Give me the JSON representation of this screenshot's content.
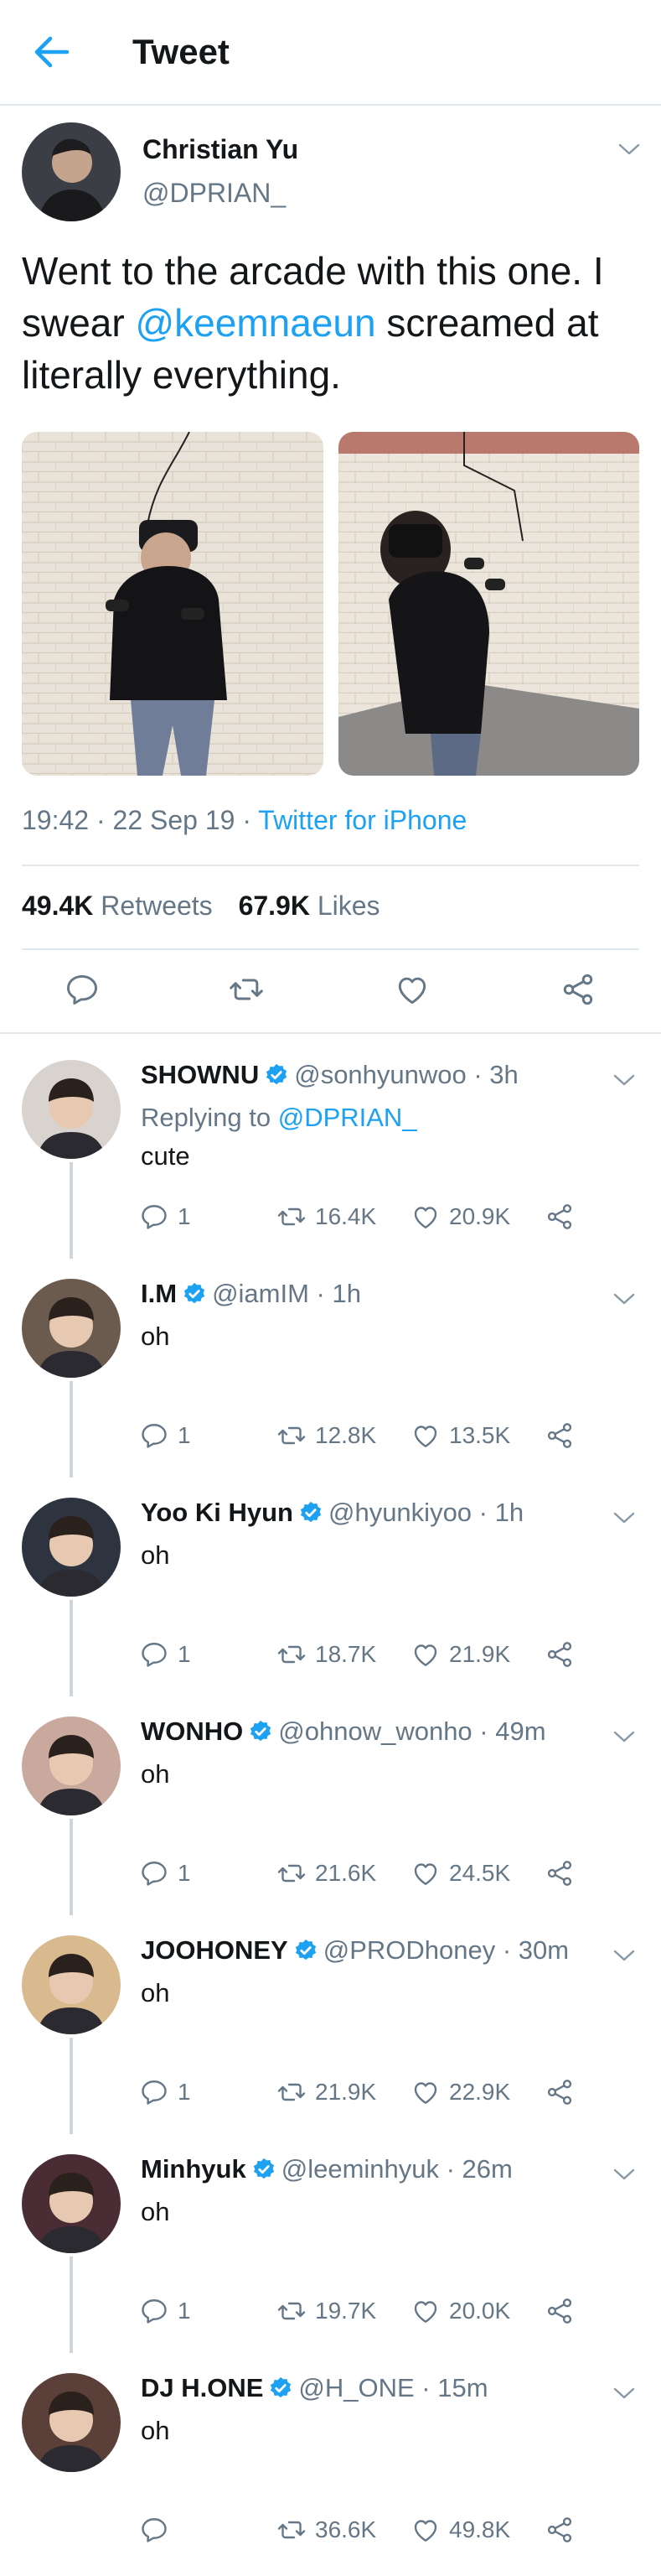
{
  "header": {
    "title": "Tweet"
  },
  "tweet": {
    "author_name": "Christian Yu",
    "author_handle": "@DPRIAN_",
    "text_before": "Went to the arcade with this one. I swear ",
    "mention": "@keemnaeun",
    "text_after": " screamed at literally everything.",
    "time_date": "19:42 · 22 Sep 19 · ",
    "source": "Twitter for iPhone",
    "retweets_count": "49.4K",
    "retweets_label": "Retweets",
    "likes_count": "67.9K",
    "likes_label": "Likes"
  },
  "replies": [
    {
      "name": "SHOWNU",
      "handle": "@sonhyunwoo · 3h",
      "replying_label": "Replying to ",
      "replying_to": "@DPRIAN_",
      "text": "cute",
      "reply_count": "1",
      "retweets": "16.4K",
      "likes": "20.9K",
      "avatar_color": "#d8d3cf"
    },
    {
      "name": "I.M",
      "handle": "@iamIM · 1h",
      "text": "oh",
      "reply_count": "1",
      "retweets": "12.8K",
      "likes": "13.5K",
      "avatar_color": "#6b5a4e"
    },
    {
      "name": "Yoo Ki Hyun",
      "handle": "@hyunkiyoo · 1h",
      "text": "oh",
      "reply_count": "1",
      "retweets": "18.7K",
      "likes": "21.9K",
      "avatar_color": "#2d3440"
    },
    {
      "name": "WONHO",
      "handle": "@ohnow_wonho · 49m",
      "text": "oh",
      "reply_count": "1",
      "retweets": "21.6K",
      "likes": "24.5K",
      "avatar_color": "#c9a89e"
    },
    {
      "name": "JOOHONEY",
      "handle": "@PRODhoney · 30m",
      "text": "oh",
      "reply_count": "1",
      "retweets": "21.9K",
      "likes": "22.9K",
      "avatar_color": "#d9b98e"
    },
    {
      "name": "Minhyuk",
      "handle": "@leeminhyuk · 26m",
      "text": "oh",
      "reply_count": "1",
      "retweets": "19.7K",
      "likes": "20.0K",
      "avatar_color": "#4a2c35"
    },
    {
      "name": "DJ H.ONE",
      "handle": "@H_ONE · 15m",
      "text": "oh",
      "reply_count": "",
      "retweets": "36.6K",
      "likes": "49.8K",
      "avatar_color": "#5a4038"
    }
  ],
  "colors": {
    "accent": "#1da1f2",
    "muted": "#657786",
    "border": "#e1e8ed"
  },
  "icons": [
    "back-arrow-icon",
    "chevron-down-icon",
    "reply-icon",
    "retweet-icon",
    "like-icon",
    "share-icon",
    "verified-badge-icon"
  ]
}
